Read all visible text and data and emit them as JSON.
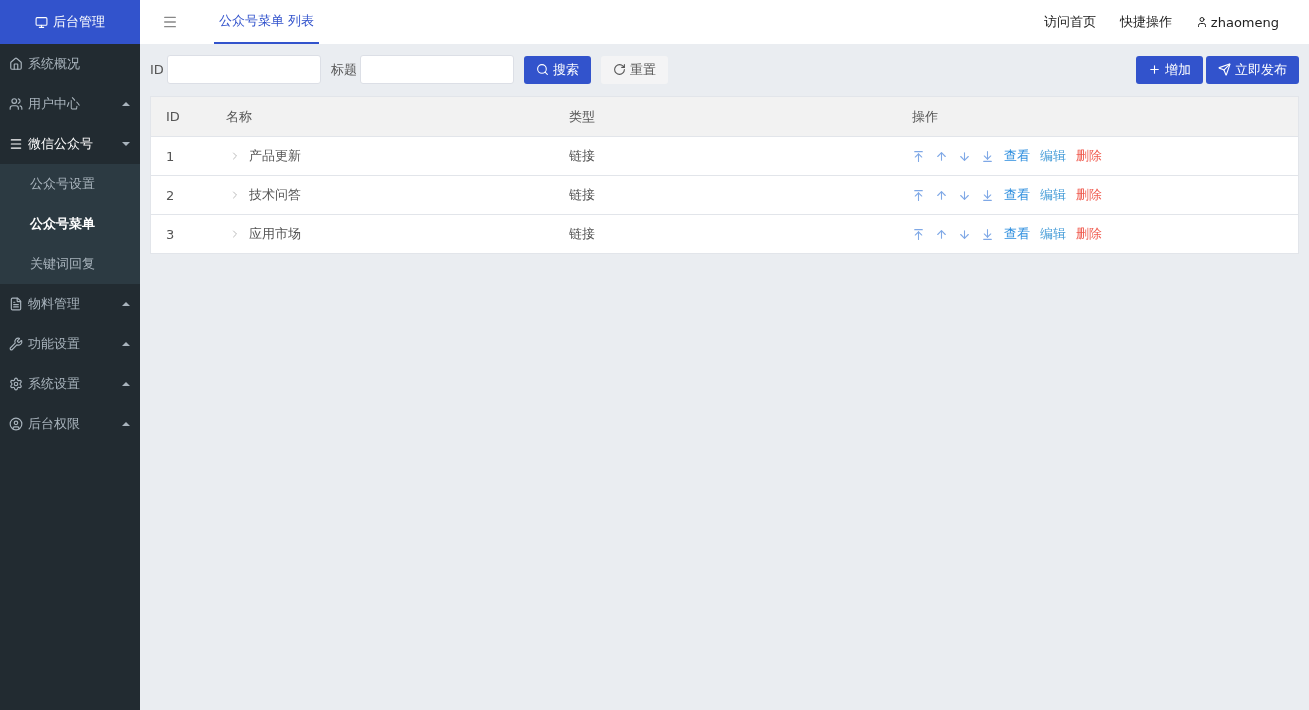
{
  "brand": {
    "title": "后台管理"
  },
  "sidebar": {
    "items": [
      {
        "label": "系统概况"
      },
      {
        "label": "用户中心",
        "expanded": false
      },
      {
        "label": "微信公众号",
        "expanded": true,
        "children": [
          {
            "label": "公众号设置",
            "selected": false
          },
          {
            "label": "公众号菜单",
            "selected": true
          },
          {
            "label": "关键词回复",
            "selected": false
          }
        ]
      },
      {
        "label": "物料管理",
        "expanded": false
      },
      {
        "label": "功能设置",
        "expanded": false
      },
      {
        "label": "系统设置",
        "expanded": false
      },
      {
        "label": "后台权限",
        "expanded": false
      }
    ]
  },
  "header": {
    "tabs": [
      {
        "label": "公众号菜单 列表",
        "selected": true
      }
    ],
    "links": [
      "访问首页",
      "快捷操作"
    ],
    "user": "zhaomeng"
  },
  "filters": [
    {
      "label": "ID"
    },
    {
      "label": "标题"
    }
  ],
  "buttons": [
    {
      "label": "搜索",
      "kind": "search"
    },
    {
      "label": "重置",
      "kind": "reset"
    }
  ],
  "actions": [
    {
      "label": "增加",
      "kind": "add"
    },
    {
      "label": "立即发布",
      "kind": "publish"
    }
  ],
  "table": {
    "columns": [
      "ID",
      "名称",
      "类型",
      "操作"
    ],
    "rows": [
      {
        "id": "1",
        "name": "产品更新",
        "type": "链接",
        "links": [
          {
            "label": "查看",
            "kind": "view"
          },
          {
            "label": "编辑",
            "kind": "edit"
          },
          {
            "label": "删除",
            "kind": "delete"
          }
        ]
      },
      {
        "id": "2",
        "name": "技术问答",
        "type": "链接",
        "links": [
          {
            "label": "查看",
            "kind": "view"
          },
          {
            "label": "编辑",
            "kind": "edit"
          },
          {
            "label": "删除",
            "kind": "delete"
          }
        ]
      },
      {
        "id": "3",
        "name": "应用市场",
        "type": "链接",
        "links": [
          {
            "label": "查看",
            "kind": "view"
          },
          {
            "label": "编辑",
            "kind": "edit"
          },
          {
            "label": "删除",
            "kind": "delete"
          }
        ]
      }
    ]
  }
}
